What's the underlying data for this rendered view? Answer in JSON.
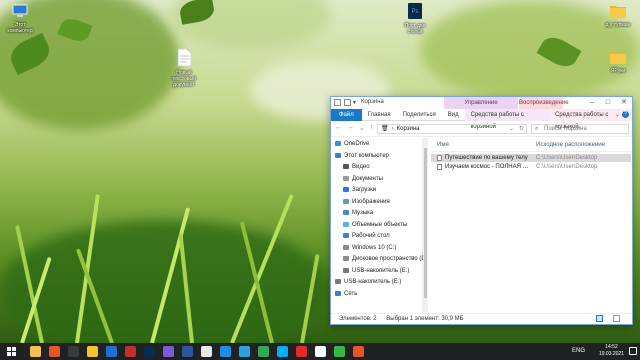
{
  "desktop": {
    "icons": [
      {
        "label": "Этот компьютер"
      },
      {
        "label": "Пост две статьи",
        "badge": "Ps"
      },
      {
        "label": "Новый текстовый документ"
      },
      {
        "label": "д у тулман"
      },
      {
        "label": "ЯРуки"
      }
    ]
  },
  "window": {
    "title": "Корзина",
    "context_tabs": {
      "manage": "Управление",
      "playback": "Воспроизведение"
    },
    "ribbon_tabs": [
      "Файл",
      "Главная",
      "Поделиться",
      "Вид",
      "Средства работы с корзиной",
      "Средства работы с музыкой"
    ],
    "address": {
      "root_glyph": "🗑",
      "path": "Корзина"
    },
    "search": {
      "placeholder": "Поиск: Корзина"
    },
    "sidebar": [
      {
        "label": "OneDrive",
        "color": "#3b8ee0",
        "indent": 0
      },
      {
        "label": "Этот компьютер",
        "color": "#3f7fd0",
        "indent": 0
      },
      {
        "label": "Видео",
        "color": "#555555",
        "indent": 1
      },
      {
        "label": "Документы",
        "color": "#9a9a9a",
        "indent": 1
      },
      {
        "label": "Загрузки",
        "color": "#2d7ad6",
        "indent": 1
      },
      {
        "label": "Изображения",
        "color": "#5a9bd8",
        "indent": 1
      },
      {
        "label": "Музыка",
        "color": "#4a88d0",
        "indent": 1
      },
      {
        "label": "Объемные объекты",
        "color": "#5ab0e8",
        "indent": 1
      },
      {
        "label": "Рабочий стол",
        "color": "#3f7fd0",
        "indent": 1
      },
      {
        "label": "Windows 10 (C:)",
        "color": "#8a8a8a",
        "indent": 1
      },
      {
        "label": "Дисковое пространство (D:",
        "color": "#8a8a8a",
        "indent": 1
      },
      {
        "label": "USB-накопитель (E:)",
        "color": "#7a7a7a",
        "indent": 1
      },
      {
        "label": "USB-накопитель (E:)",
        "color": "#7a7a7a",
        "indent": 0
      },
      {
        "label": "Сеть",
        "color": "#3f7fd0",
        "indent": 0
      }
    ],
    "columns": {
      "name": "Имя",
      "location": "Исходное расположение"
    },
    "files": [
      {
        "name": "Путешествие по вашему телу",
        "location": "C:\\Users\\User\\Desktop",
        "selected": true
      },
      {
        "name": "Изучаем космос - ПОЛНАЯ ВЕРС...",
        "location": "C:\\Users\\User\\Desktop",
        "selected": false
      }
    ],
    "status": {
      "count": "Элементов: 2",
      "selection": "Выбран 1 элемент: 30,9 МБ"
    }
  },
  "taskbar": {
    "apps": [
      {
        "name": "file-explorer-icon",
        "color": "#f2c14e"
      },
      {
        "name": "video-editor-icon",
        "color": "#e8552b"
      },
      {
        "name": "movie-icon",
        "color": "#3a3a3a"
      },
      {
        "name": "movavi-icon",
        "color": "#f4c430"
      },
      {
        "name": "player-icon",
        "color": "#1f6fd1"
      },
      {
        "name": "filezilla-icon",
        "color": "#c62d2d"
      },
      {
        "name": "photoshop-icon",
        "color": "#0b2b4a"
      },
      {
        "name": "app-icon",
        "color": "#7d5ad6"
      },
      {
        "name": "word-icon",
        "color": "#2b579a"
      },
      {
        "name": "paint-icon",
        "color": "#e8e8e8"
      },
      {
        "name": "media-icon",
        "color": "#1c8fe0"
      },
      {
        "name": "telegram-icon",
        "color": "#2aa3de"
      },
      {
        "name": "chrome-icon",
        "color": "#34a853"
      },
      {
        "name": "skype-icon",
        "color": "#00aff0"
      },
      {
        "name": "opera-icon",
        "color": "#e32a2a"
      },
      {
        "name": "yandex-icon",
        "color": "#ffffff"
      },
      {
        "name": "camtasia-icon",
        "color": "#39b54a"
      },
      {
        "name": "recorder-icon",
        "color": "#e8552b"
      }
    ],
    "lang": "ENG",
    "time": "14:52",
    "date": "19.03.2021"
  }
}
